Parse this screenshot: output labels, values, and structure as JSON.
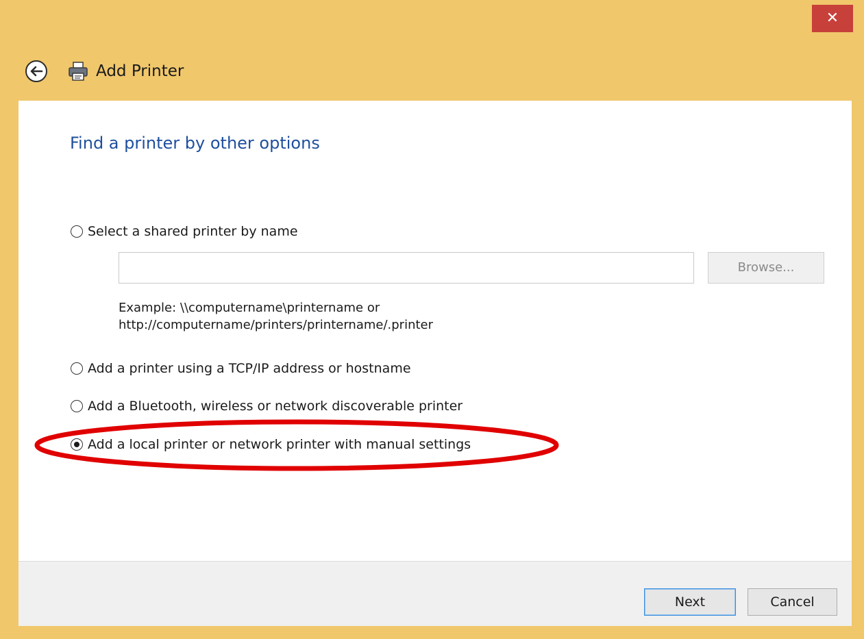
{
  "window": {
    "title": "Add Printer",
    "close_glyph": "✕"
  },
  "icons": {
    "back": "back-arrow-icon",
    "printer": "printer-icon",
    "close": "close-icon"
  },
  "colors": {
    "titlebar": "#f0c76b",
    "close_button": "#c7403a",
    "heading": "#1e4f9e",
    "annotation": "#e00000"
  },
  "page": {
    "heading": "Find a printer by other options"
  },
  "options": [
    {
      "label": "Select a shared printer by name",
      "checked": false
    },
    {
      "label": "Add a printer using a TCP/IP address or hostname",
      "checked": false
    },
    {
      "label": "Add a Bluetooth, wireless or network discoverable printer",
      "checked": false
    },
    {
      "label": "Add a local printer or network printer with manual settings",
      "checked": true
    }
  ],
  "shared_printer": {
    "value": "",
    "placeholder": "",
    "browse_label": "Browse...",
    "example_line1": "Example: \\\\computername\\printername or",
    "example_line2": "http://computername/printers/printername/.printer"
  },
  "footer": {
    "next_label": "Next",
    "cancel_label": "Cancel"
  }
}
